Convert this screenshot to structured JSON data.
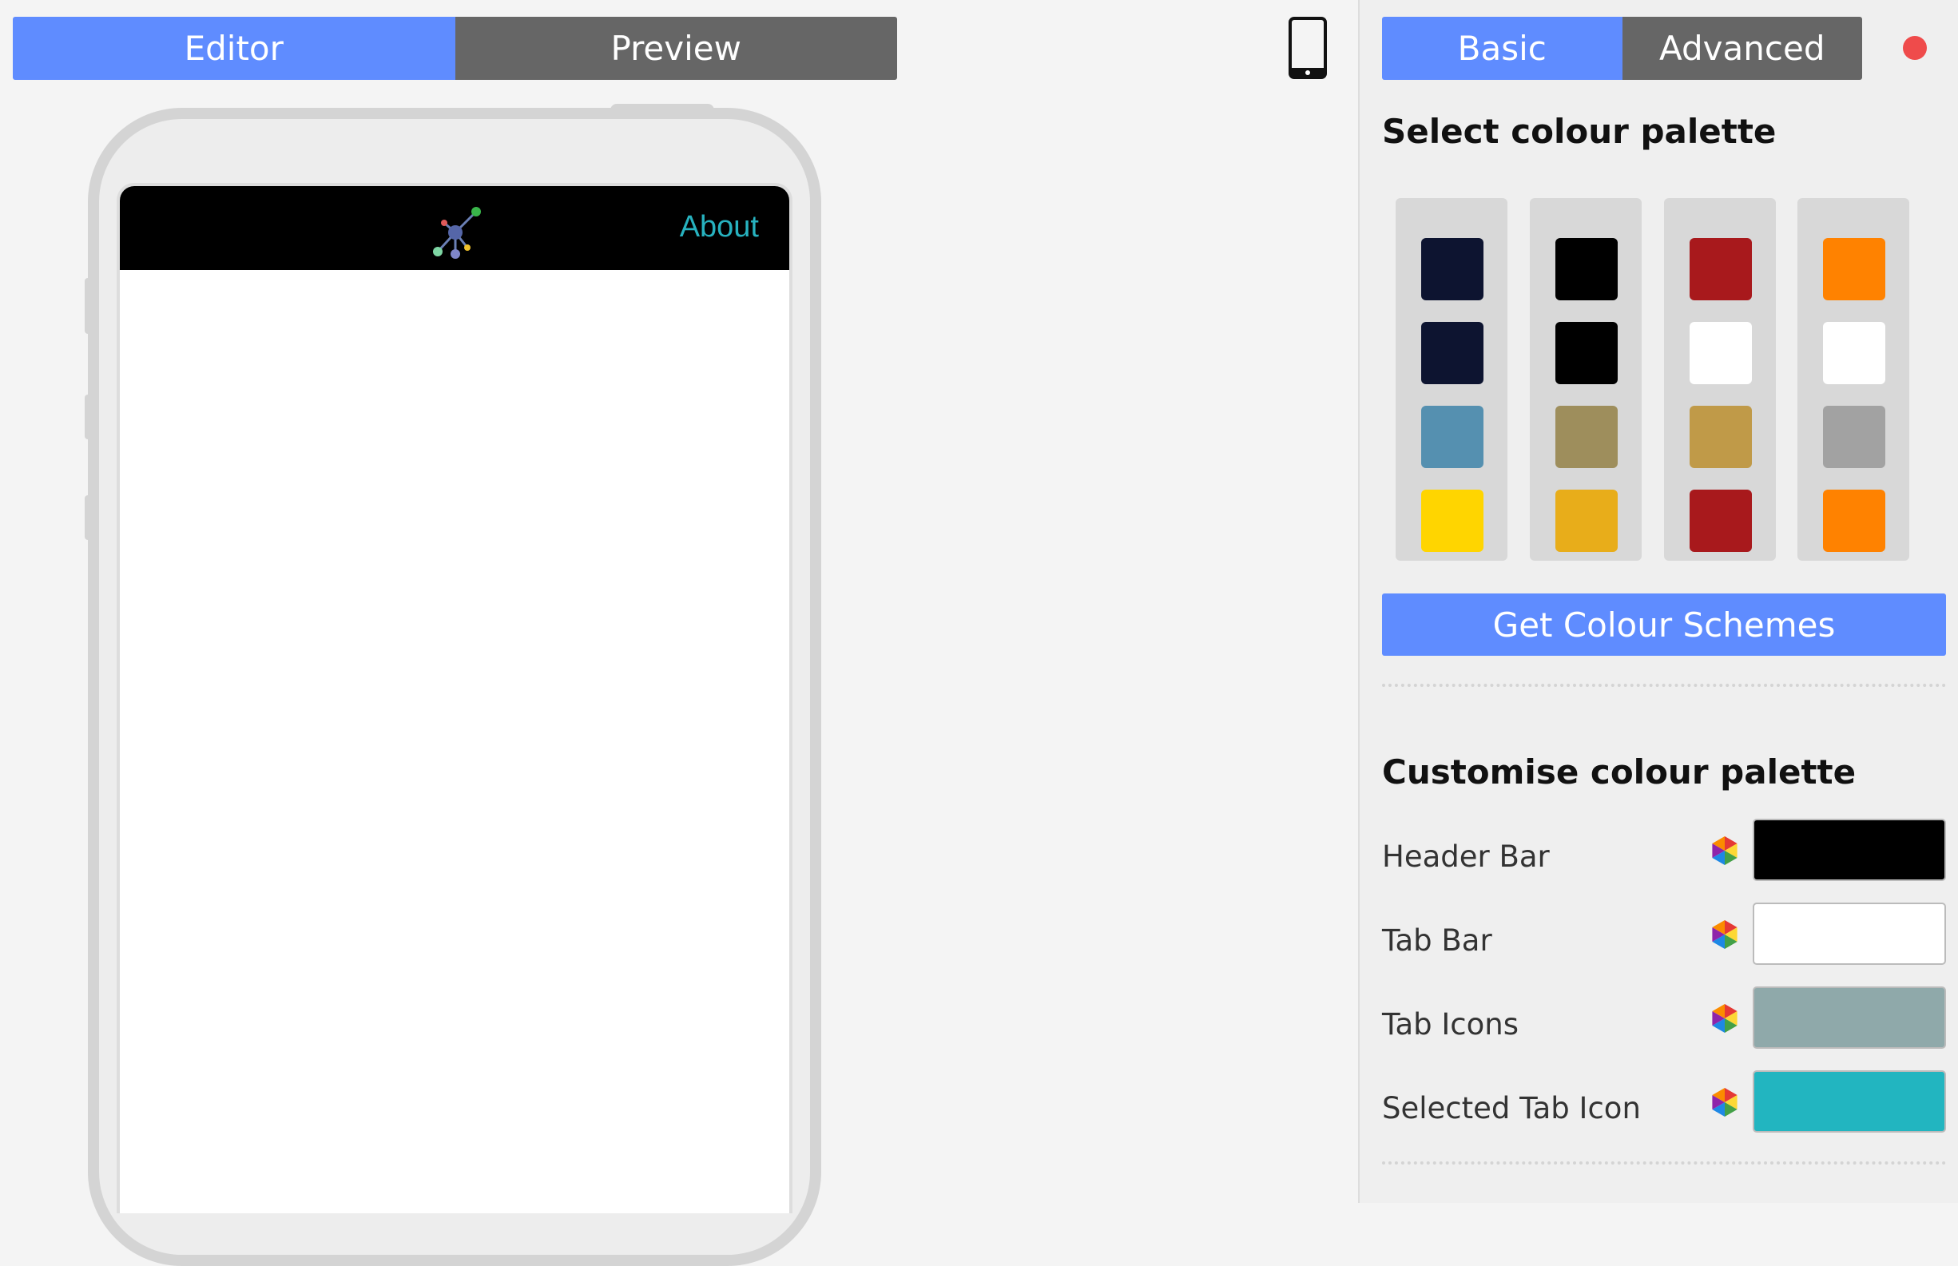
{
  "main_tabs": {
    "editor": "Editor",
    "preview": "Preview"
  },
  "device_toggle_icon": "phone-icon",
  "app_preview": {
    "about_label": "About",
    "logo_icon": "network-logo-icon"
  },
  "side_tabs": {
    "basic": "Basic",
    "advanced": "Advanced"
  },
  "select_palette": {
    "title": "Select colour palette",
    "palettes": [
      {
        "colors": [
          "#0d1430",
          "#0d1430",
          "#5590b0",
          "#ffd500"
        ]
      },
      {
        "colors": [
          "#000000",
          "#000000",
          "#9e8e5c",
          "#e8ad1a"
        ]
      },
      {
        "colors": [
          "#a8191c",
          "#ffffff",
          "#c09a48",
          "#a8191c"
        ]
      },
      {
        "colors": [
          "#ff8200",
          "#ffffff",
          "#a2a2a2",
          "#ff8200"
        ]
      }
    ]
  },
  "get_schemes_label": "Get Colour Schemes",
  "customise": {
    "title": "Customise colour palette",
    "rows": [
      {
        "label": "Header Bar",
        "color": "#000000"
      },
      {
        "label": "Tab Bar",
        "color": "#ffffff"
      },
      {
        "label": "Tab Icons",
        "color": "#8fa9aa"
      },
      {
        "label": "Selected Tab Icon",
        "color": "#22b5c0"
      }
    ]
  }
}
